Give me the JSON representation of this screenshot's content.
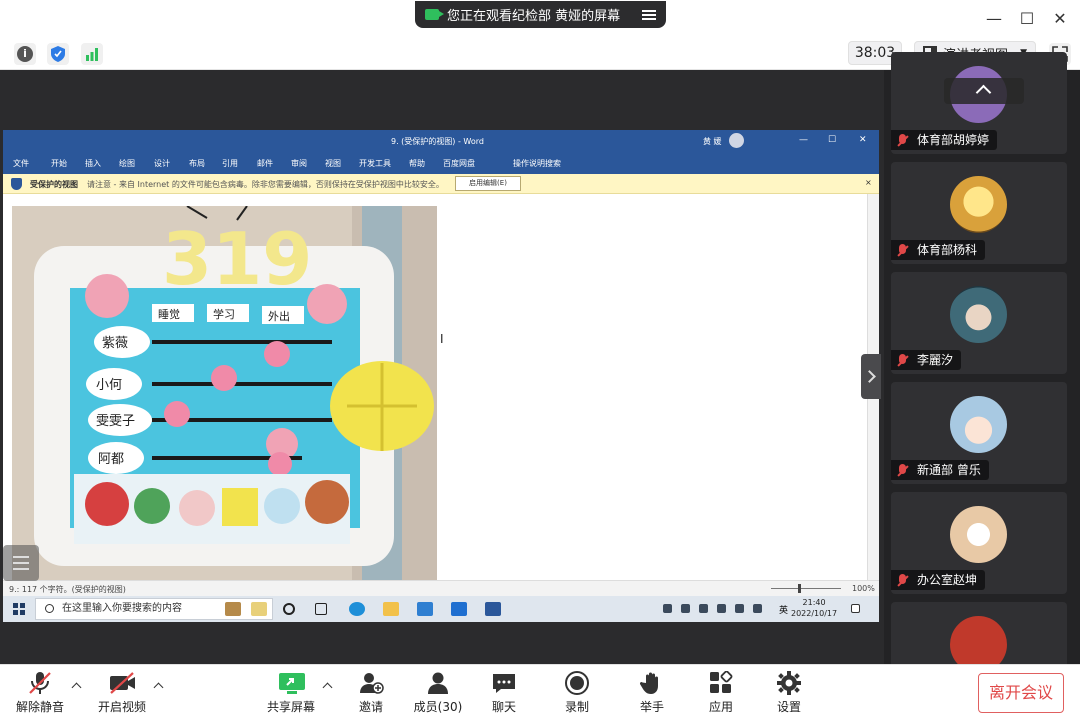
{
  "titlebar": {
    "share_notice": "您正在观看纪检部 黄娅的屏幕",
    "minimize": "—",
    "maximize": "☐",
    "close": "✕"
  },
  "toolbar": {
    "timer": "38:03",
    "view_mode": "演讲者视图"
  },
  "word": {
    "doc_title": "9. (受保护的视图)  -  Word",
    "user": "黄 媛",
    "ribbon_tabs": [
      "文件",
      "开始",
      "插入",
      "绘图",
      "设计",
      "布局",
      "引用",
      "邮件",
      "审阅",
      "视图",
      "开发工具",
      "帮助",
      "百度网盘",
      "操作说明搜索"
    ],
    "protect_label": "受保护的视图",
    "protect_msg": "请注意 - 来自 Internet 的文件可能包含病毒。除非您需要编辑，否则保持在受保护视图中比较安全。",
    "enable_editing": "启用编辑(E)",
    "status_left": "9.: 117 个字符。(受保护的视图)",
    "zoom": "100%",
    "taskbar_search": "在这里输入你要搜索的内容",
    "tray_lang": "英",
    "clock_time": "21:40",
    "clock_date": "2022/10/17",
    "photo_title": "319",
    "photo_headers": [
      "睡觉",
      "学习",
      "外出"
    ],
    "photo_names": [
      "紫薇",
      "小何",
      "雯雯子",
      "阿都"
    ]
  },
  "participants": [
    {
      "name": "体育部胡婷婷",
      "color": "#8b6bb8"
    },
    {
      "name": "体育部杨科",
      "color": "#d9a13b"
    },
    {
      "name": "李麗汐",
      "color": "#3f6a78"
    },
    {
      "name": "新通部 曾乐",
      "color": "#a8c9e2"
    },
    {
      "name": "办公室赵坤",
      "color": "#e8c9a6"
    },
    {
      "name": "",
      "color": "#c0392b"
    }
  ],
  "bottombar": {
    "unmute": "解除静音",
    "start_video": "开启视频",
    "share_screen": "共享屏幕",
    "invite": "邀请",
    "members": "成员(30)",
    "chat": "聊天",
    "record": "录制",
    "raise_hand": "举手",
    "apps": "应用",
    "settings": "设置",
    "leave": "离开会议"
  }
}
